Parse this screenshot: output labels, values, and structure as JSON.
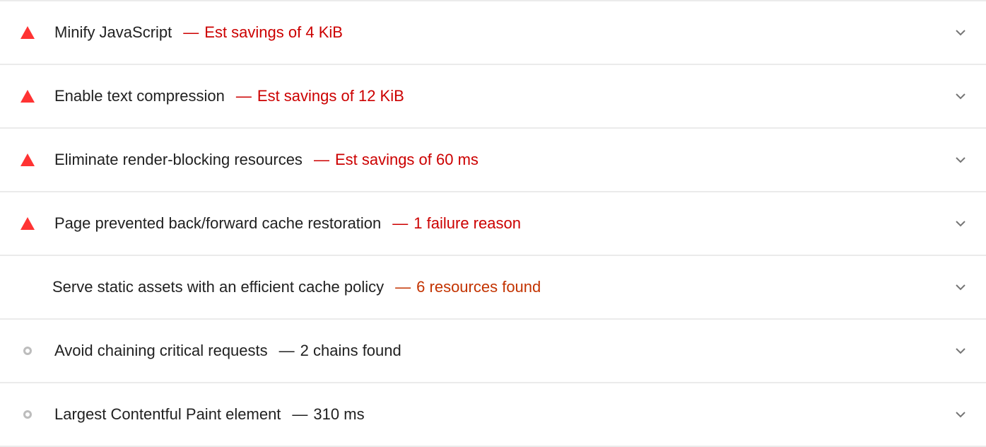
{
  "audits": [
    {
      "title": "Minify JavaScript",
      "separator": "—",
      "value": "Est savings of 4 KiB",
      "status": "fail",
      "icon": "red-triangle-icon",
      "color": "#cc0000"
    },
    {
      "title": "Enable text compression",
      "separator": "—",
      "value": "Est savings of 12 KiB",
      "status": "fail",
      "icon": "red-triangle-icon",
      "color": "#cc0000"
    },
    {
      "title": "Eliminate render-blocking resources",
      "separator": "—",
      "value": "Est savings of 60 ms",
      "status": "fail",
      "icon": "red-triangle-icon",
      "color": "#cc0000"
    },
    {
      "title": "Page prevented back/forward cache restoration",
      "separator": "—",
      "value": "1 failure reason",
      "status": "fail",
      "icon": "red-triangle-icon",
      "color": "#cc0000"
    },
    {
      "title": "Serve static assets with an efficient cache policy",
      "separator": "—",
      "value": "6 resources found",
      "status": "average",
      "icon": "",
      "color": "#c33300"
    },
    {
      "title": "Avoid chaining critical requests",
      "separator": "—",
      "value": "2 chains found",
      "status": "info",
      "icon": "gray-circle-icon",
      "color": "#212121"
    },
    {
      "title": "Largest Contentful Paint element",
      "separator": "—",
      "value": "310 ms",
      "status": "info",
      "icon": "gray-circle-icon",
      "color": "#212121"
    }
  ],
  "colors": {
    "fail": "#ff3333",
    "fail_text": "#cc0000",
    "average_text": "#c33300",
    "info_icon": "#bdbdbd",
    "divider": "#ebebeb"
  }
}
